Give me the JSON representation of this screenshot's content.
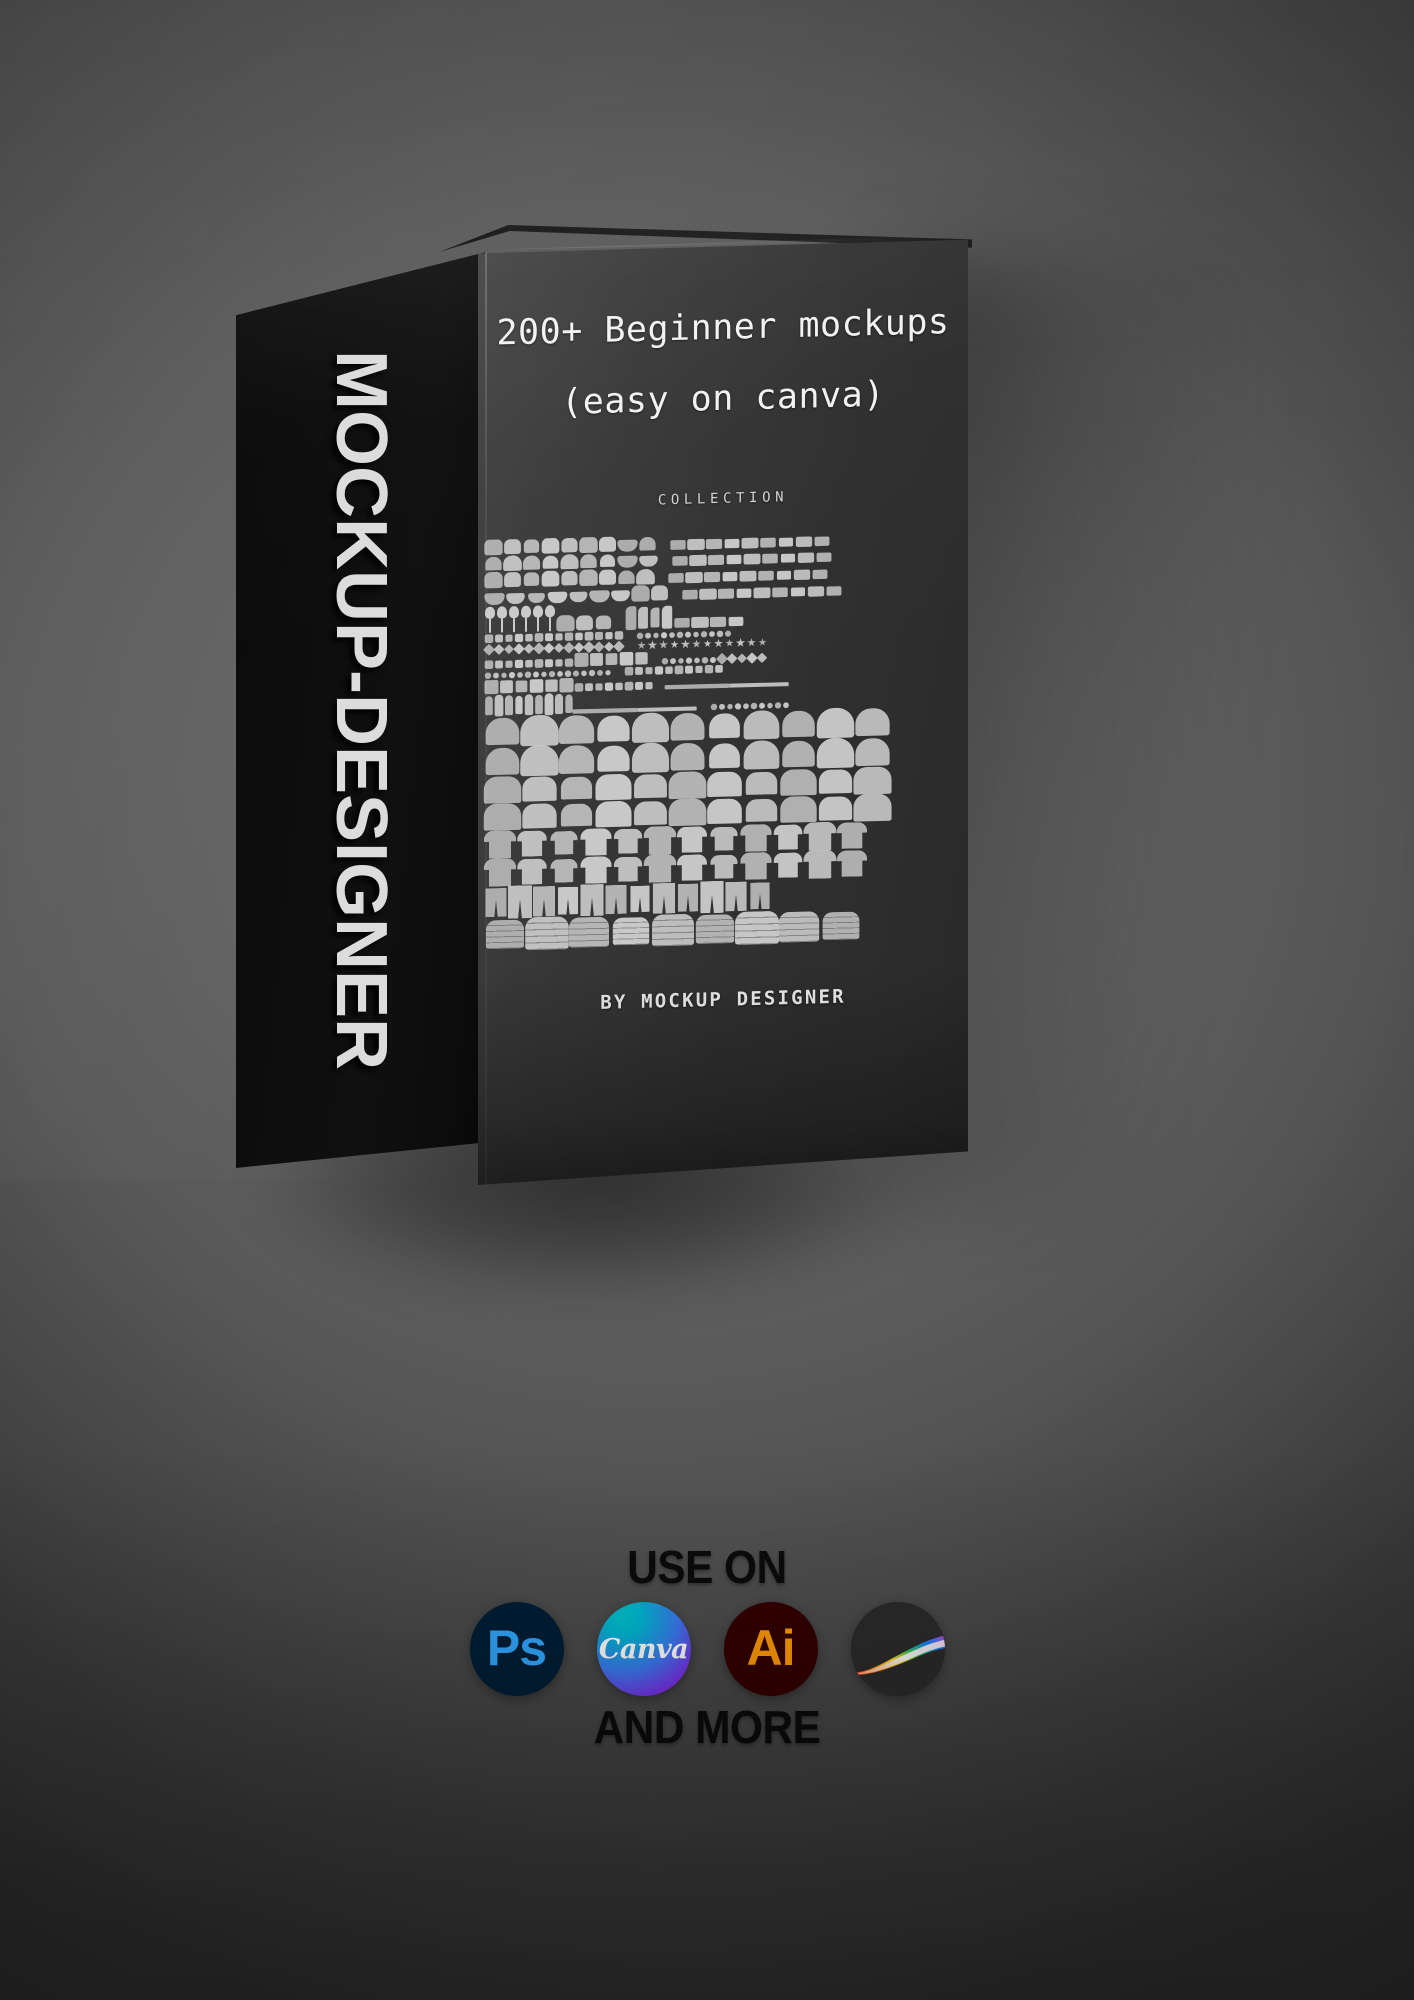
{
  "product": {
    "box": {
      "spine_label": "MOCKUP-DESIGNER",
      "title_line_1": "200+ Beginner mockups",
      "title_line_2": "(easy on canva)",
      "collection_label": "COLLECTION",
      "byline": "BY MOCKUP DESIGNER"
    },
    "footer": {
      "use_on_label": "USE ON",
      "and_more_label": "AND MORE",
      "apps": [
        {
          "name": "Photoshop",
          "glyph": "Ps",
          "bg": "#001E36",
          "fg": "#31A8FF"
        },
        {
          "name": "Canva",
          "glyph": "Canva",
          "bg": "#00C4CC",
          "fg": "#FFFFFF"
        },
        {
          "name": "Illustrator",
          "glyph": "Ai",
          "bg": "#330000",
          "fg": "#FF9A00"
        },
        {
          "name": "Procreate",
          "glyph": "",
          "bg": "#2B2B2B",
          "fg": "#FF5A5A"
        }
      ]
    }
  },
  "colors": {
    "background_light": "#6a6a6a",
    "background_dark": "#333333",
    "box_front": "#303030",
    "box_spine": "#0c0c0c",
    "text_light": "#f2f2f2",
    "text_dark": "#0b0b0b",
    "silhouette": "#c9c9c9"
  }
}
